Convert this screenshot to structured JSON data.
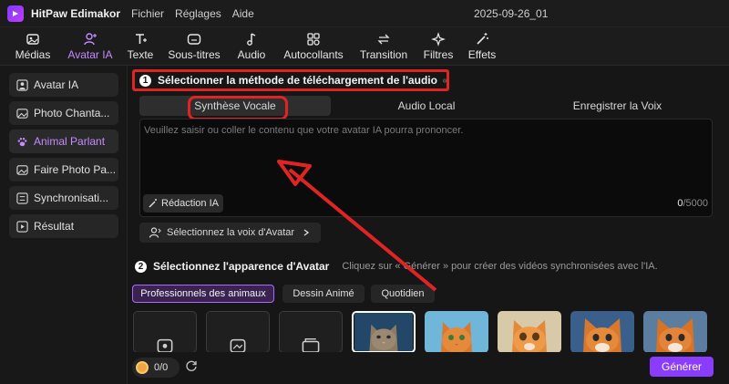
{
  "app": {
    "title": "HitPaw Edimakor",
    "menu": [
      "Fichier",
      "Réglages",
      "Aide"
    ],
    "document": "2025-09-26_01"
  },
  "toolbar": {
    "items": [
      {
        "label": "Médias",
        "icon": "image-icon"
      },
      {
        "label": "Avatar IA",
        "icon": "avatar-icon"
      },
      {
        "label": "Texte",
        "icon": "text-icon"
      },
      {
        "label": "Sous-titres",
        "icon": "subtitles-icon"
      },
      {
        "label": "Audio",
        "icon": "music-note-icon"
      },
      {
        "label": "Autocollants",
        "icon": "stickers-icon"
      },
      {
        "label": "Transition",
        "icon": "transition-icon"
      },
      {
        "label": "Filtres",
        "icon": "sparkle-icon"
      },
      {
        "label": "Effets",
        "icon": "magic-wand-icon"
      }
    ],
    "active_index": 1,
    "accent": "#c58bff"
  },
  "sidebar": {
    "items": [
      {
        "label": "Avatar IA",
        "icon": "user-icon"
      },
      {
        "label": "Photo Chanta...",
        "icon": "photo-icon"
      },
      {
        "label": "Animal Parlant",
        "icon": "paw-icon"
      },
      {
        "label": "Faire Photo Pa...",
        "icon": "photo-icon"
      },
      {
        "label": "Synchronisati...",
        "icon": "sync-icon"
      },
      {
        "label": "Résultat",
        "icon": "play-icon"
      }
    ],
    "active_index": 2
  },
  "step1": {
    "number": "1",
    "title": "Sélectionner la méthode de téléchargement de l'audio",
    "tabs": [
      "Synthèse Vocale",
      "Audio Local",
      "Enregistrer la Voix"
    ],
    "selected_tab": 0,
    "textarea": {
      "placeholder": "Veuillez saisir ou coller le contenu que votre avatar IA pourra prononcer.",
      "value": ""
    },
    "redaction_label": "Rédaction IA",
    "counter": {
      "current": "0",
      "max": "/5000"
    },
    "voice_button": "Sélectionnez la voix d'Avatar"
  },
  "step2": {
    "number": "2",
    "title": "Sélectionnez l'apparence d'Avatar",
    "hint": "Cliquez sur « Générer » pour créer des vidéos synchronisées avec l'IA.",
    "categories": [
      "Professionnels des animaux",
      "Dessin Animé",
      "Quotidien"
    ],
    "active_category": 0,
    "thumbnails": [
      {
        "icon": "add-photo-icon"
      },
      {
        "icon": "add-image-icon"
      },
      {
        "icon": "folder-icon"
      },
      {
        "icon": "cat-avatar-icon"
      },
      {
        "icon": "cat-avatar-icon"
      },
      {
        "icon": "cat-avatar-icon"
      },
      {
        "icon": "fox-avatar-icon"
      },
      {
        "icon": "fox-avatar-icon"
      }
    ]
  },
  "footer": {
    "credits": "0/0",
    "generate_label": "Générer",
    "generate_color": "#8b3dff"
  },
  "annotation_color": "#e02424"
}
